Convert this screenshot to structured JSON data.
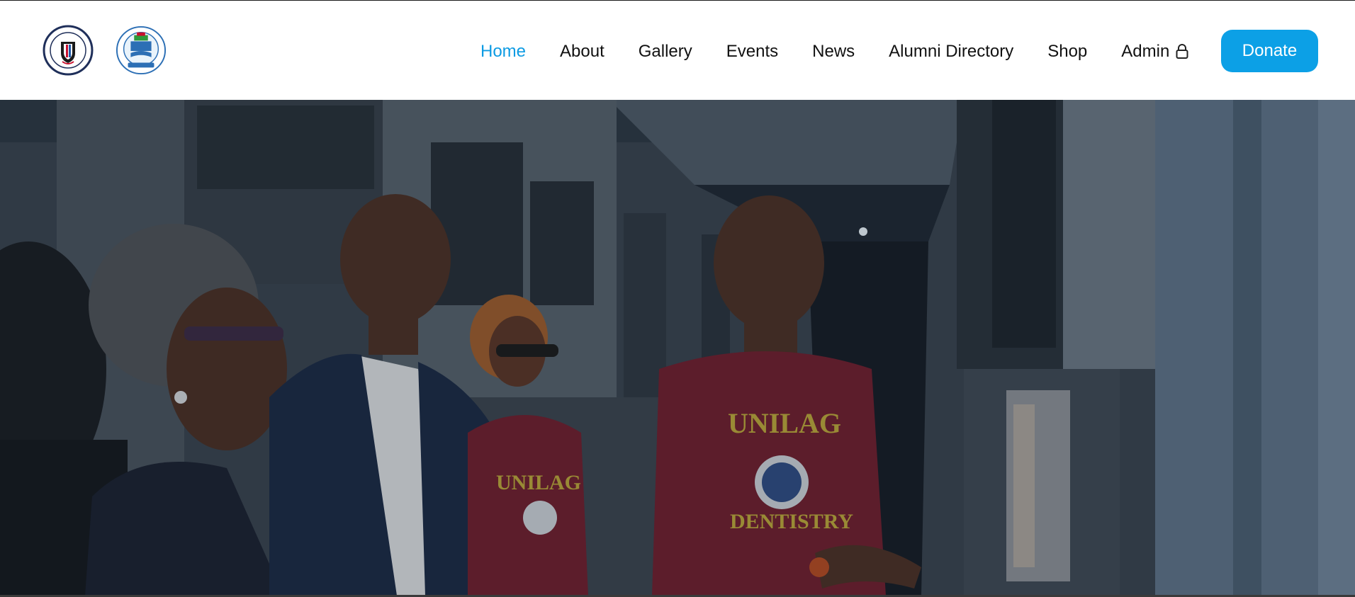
{
  "header": {
    "logos": [
      {
        "name": "College of Medicine logo",
        "icon": "crest-logo"
      },
      {
        "name": "University of Lagos logo",
        "icon": "university-crest-logo"
      }
    ],
    "nav": [
      {
        "label": "Home",
        "active": true
      },
      {
        "label": "About"
      },
      {
        "label": "Gallery"
      },
      {
        "label": "Events"
      },
      {
        "label": "News"
      },
      {
        "label": "Alumni Directory"
      },
      {
        "label": "Shop"
      },
      {
        "label": "Admin",
        "icon": "lock-icon"
      }
    ],
    "donate_label": "Donate"
  },
  "hero": {
    "shirt_text_top": "UNILAG",
    "shirt_text_bottom": "DENTISTRY"
  },
  "colors": {
    "accent": "#0ca0e6",
    "active_link": "#0d9be3",
    "shirt_maroon": "#6e1f2e",
    "shirt_print": "#b9a43a"
  }
}
